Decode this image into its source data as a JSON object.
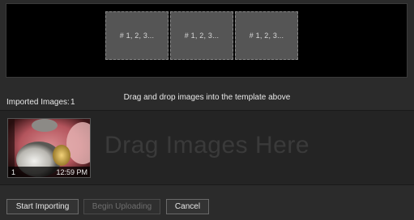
{
  "template": {
    "slots": [
      {
        "label": "# 1, 2, 3..."
      },
      {
        "label": "# 1, 2, 3..."
      },
      {
        "label": "# 1, 2, 3..."
      }
    ]
  },
  "instructions": "Drag and drop images into the template above",
  "imported": {
    "label": "Imported Images:",
    "count": "1"
  },
  "drop_area": {
    "hint": "Drag Images Here"
  },
  "thumbnails": [
    {
      "index": "1",
      "time": "12:59 PM"
    }
  ],
  "buttons": {
    "start": "Start Importing",
    "upload": "Begin Uploading",
    "cancel": "Cancel"
  }
}
